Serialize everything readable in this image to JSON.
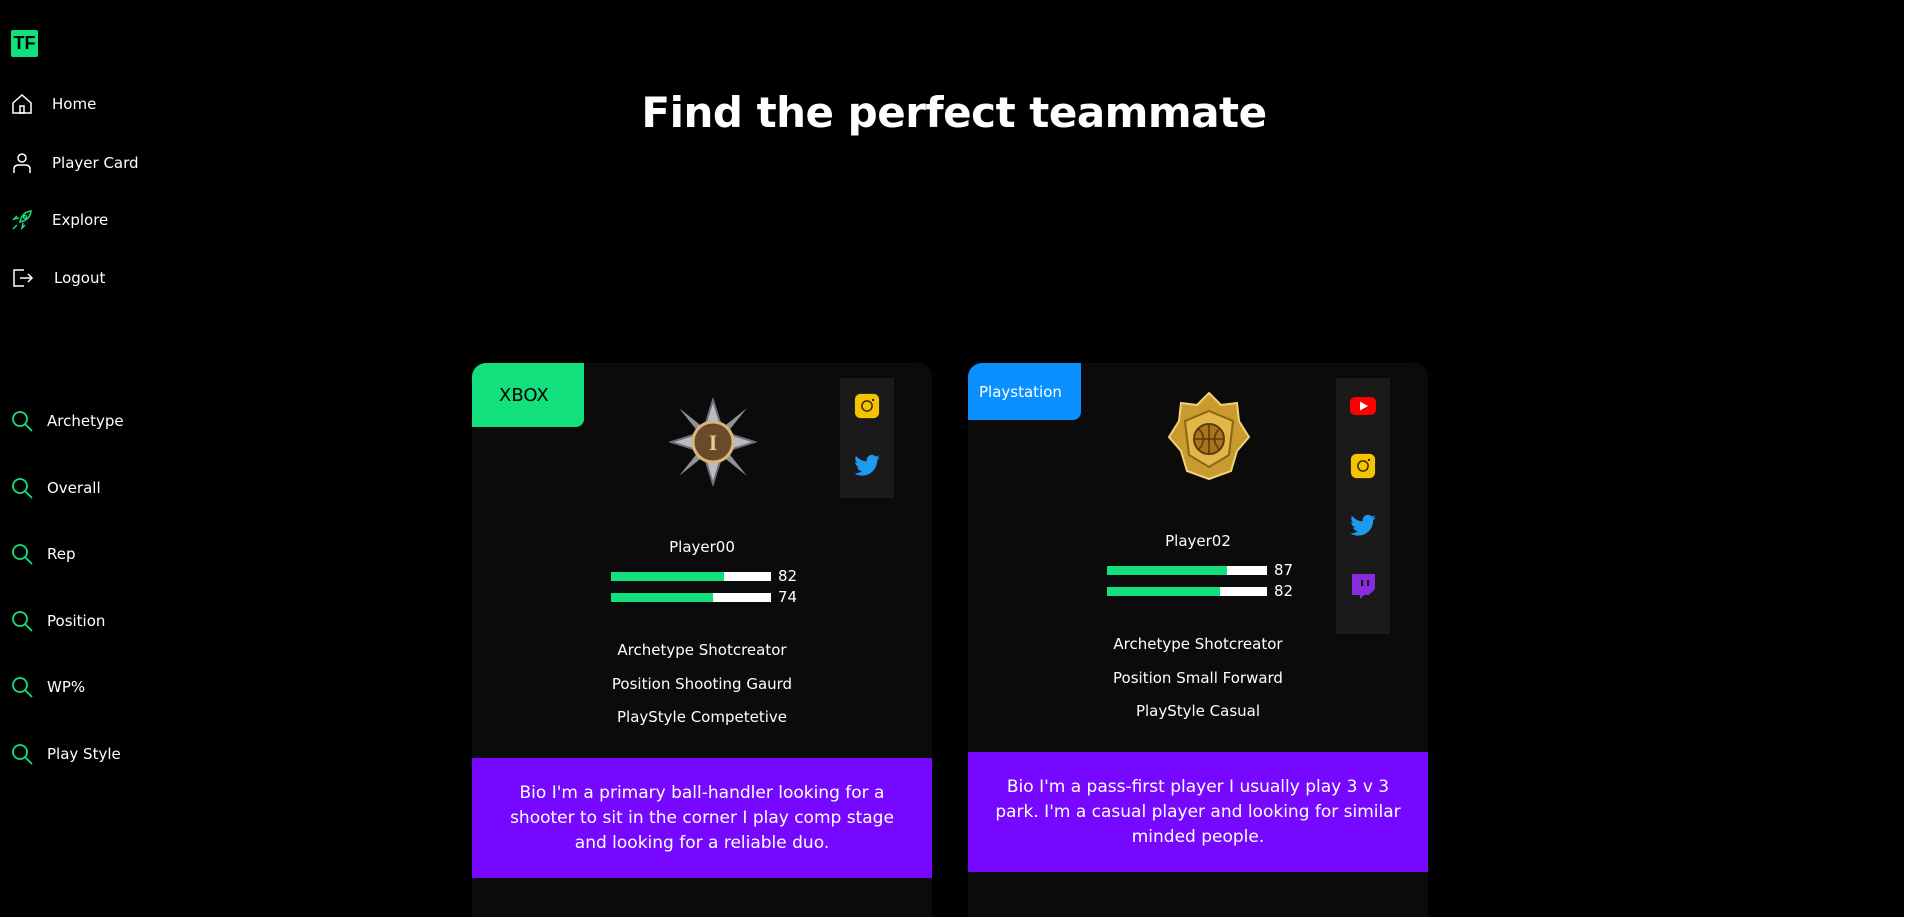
{
  "brand": {
    "logo_text": "TF"
  },
  "nav": [
    {
      "label": "Home",
      "icon": "home-icon"
    },
    {
      "label": "Player Card",
      "icon": "user-icon"
    },
    {
      "label": "Explore",
      "icon": "rocket-icon"
    },
    {
      "label": "Logout",
      "icon": "logout-icon"
    }
  ],
  "filters": [
    {
      "label": "Archetype",
      "icon": "search-icon"
    },
    {
      "label": "Overall",
      "icon": "search-icon"
    },
    {
      "label": "Rep",
      "icon": "search-icon"
    },
    {
      "label": "Position",
      "icon": "search-icon"
    },
    {
      "label": "WP%",
      "icon": "search-icon"
    },
    {
      "label": "Play Style",
      "icon": "search-icon"
    }
  ],
  "page": {
    "title": "Find the perfect teammate"
  },
  "cards": [
    {
      "platform": "XBOX",
      "platform_color": "#12e07c",
      "emblem": "silver-star-emblem-icon",
      "socials": [
        "instagram-icon",
        "twitter-icon"
      ],
      "name": "Player00",
      "stats": [
        82,
        74
      ],
      "archetype": "Archetype Shotcreator",
      "position": "Position Shooting Gaurd",
      "playstyle": "PlayStyle Competetive",
      "bio": "Bio I'm a primary ball-handler looking for a shooter to sit in the corner I play comp stage and looking for a reliable duo."
    },
    {
      "platform": "Playstation",
      "platform_color": "#0a8fff",
      "emblem": "gold-basketball-emblem-icon",
      "socials": [
        "youtube-icon",
        "instagram-icon",
        "twitter-icon",
        "twitch-icon"
      ],
      "name": "Player02",
      "stats": [
        87,
        82
      ],
      "archetype": "Archetype Shotcreator",
      "position": "Position Small Forward",
      "playstyle": "PlayStyle Casual",
      "bio": "Bio I'm a pass-first player I usually play 3 v 3 park. I'm a casual player and looking for similar minded people."
    }
  ],
  "colors": {
    "accent": "#12e07c",
    "bio_bg": "#7608ff",
    "card_bg": "#0b0b0b"
  }
}
